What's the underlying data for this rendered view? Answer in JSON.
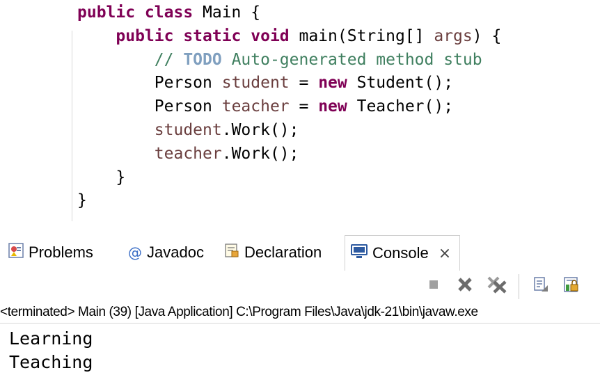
{
  "editor": {
    "lines": [
      [
        {
          "t": "public class",
          "c": "kw"
        },
        {
          "t": " Main {",
          "c": ""
        }
      ],
      [
        {
          "t": "    ",
          "c": ""
        },
        {
          "t": "public static void",
          "c": "kw"
        },
        {
          "t": " main(String[] ",
          "c": ""
        },
        {
          "t": "args",
          "c": "var"
        },
        {
          "t": ") {",
          "c": ""
        }
      ],
      [
        {
          "t": "        ",
          "c": ""
        },
        {
          "t": "// ",
          "c": "cmt"
        },
        {
          "t": "TODO",
          "c": "todo"
        },
        {
          "t": " Auto-generated method stub",
          "c": "cmt"
        }
      ],
      [
        {
          "t": "        Person ",
          "c": ""
        },
        {
          "t": "student",
          "c": "var"
        },
        {
          "t": " = ",
          "c": ""
        },
        {
          "t": "new",
          "c": "kw"
        },
        {
          "t": " Student();",
          "c": ""
        }
      ],
      [
        {
          "t": "        Person ",
          "c": ""
        },
        {
          "t": "teacher",
          "c": "var"
        },
        {
          "t": " = ",
          "c": ""
        },
        {
          "t": "new",
          "c": "kw"
        },
        {
          "t": " Teacher();",
          "c": ""
        }
      ],
      [
        {
          "t": "        ",
          "c": ""
        },
        {
          "t": "student",
          "c": "var"
        },
        {
          "t": ".Work();",
          "c": ""
        }
      ],
      [
        {
          "t": "        ",
          "c": ""
        },
        {
          "t": "teacher",
          "c": "var"
        },
        {
          "t": ".Work();",
          "c": ""
        }
      ],
      [
        {
          "t": "    }",
          "c": ""
        }
      ],
      [
        {
          "t": "}",
          "c": ""
        }
      ]
    ]
  },
  "tabs": [
    {
      "label": "Problems",
      "icon": "problems-icon"
    },
    {
      "label": "Javadoc",
      "icon": "javadoc-icon"
    },
    {
      "label": "Declaration",
      "icon": "declaration-icon"
    },
    {
      "label": "Console",
      "icon": "console-icon",
      "active": true
    }
  ],
  "console_tab_close": "×",
  "toolbar": {
    "buttons": [
      "terminate-icon",
      "remove-launch-icon",
      "remove-all-terminated-icon",
      "clear-console-icon",
      "scroll-lock-icon"
    ]
  },
  "console": {
    "status": "<terminated> Main (39) [Java Application] C:\\Program Files\\Java\\jdk-21\\bin\\javaw.exe",
    "output": [
      "Learning",
      "Teaching"
    ]
  },
  "colors": {
    "keyword": "#7f0055",
    "variable": "#6a3e3e",
    "comment": "#3f7f5f",
    "todo": "#7f9fbf"
  }
}
